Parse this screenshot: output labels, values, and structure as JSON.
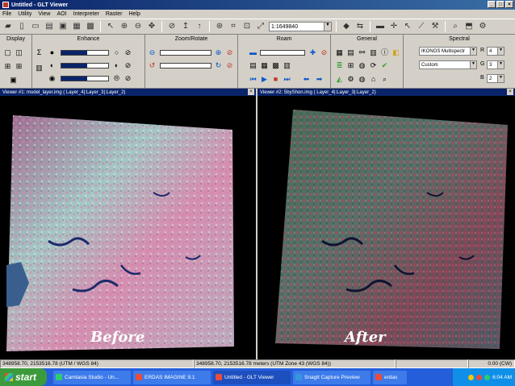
{
  "window": {
    "title": "Untitled - GLT Viewer",
    "controls": [
      "_",
      "□",
      "×"
    ]
  },
  "menu": [
    "File",
    "Utility",
    "View",
    "AOI",
    "Interpreter",
    "Raster",
    "Help"
  ],
  "toolbar": {
    "scale_value": "1:1649840"
  },
  "panels": {
    "display": "Display",
    "enhance": "Enhance",
    "zoom": "Zoom/Rotate",
    "roam": "Roam",
    "general": "General",
    "spectral": "Spectral"
  },
  "spectral": {
    "sensor": "IKONOS Multispectr",
    "preset": "Custom",
    "r_label": "R",
    "r_value": "4",
    "g_label": "G",
    "g_value": "3",
    "b_label": "B",
    "b_value": "2"
  },
  "viewers": [
    {
      "title": "Viewer #1: model_layer.img ( Layer_4|:Layer_3|:Layer_2)",
      "caption": "Before",
      "status": "348958.70, 2153516.78  (UTM / WGS 84)"
    },
    {
      "title": "Viewer #2: 5byShon.img ( Layer_4|:Layer_3|:Layer_2)",
      "caption": "After",
      "status": "348958.70, 2153516.78 meters (UTM Zone 43 (WGS 84))"
    }
  ],
  "rotation_readout": "0.00 (CW)",
  "taskbar": {
    "start": "start",
    "tasks": [
      "Camtasia Studio - Un...",
      "ERDAS IMAGINE 9.1",
      "Untitled - GLT Viewer",
      "SnagIt Capture Preview",
      "erdas"
    ],
    "clock": "6:04 AM"
  },
  "colors": {
    "title_bar": "#0a246a",
    "viewer_bg": "#000000",
    "taskbar": "#245edb"
  }
}
